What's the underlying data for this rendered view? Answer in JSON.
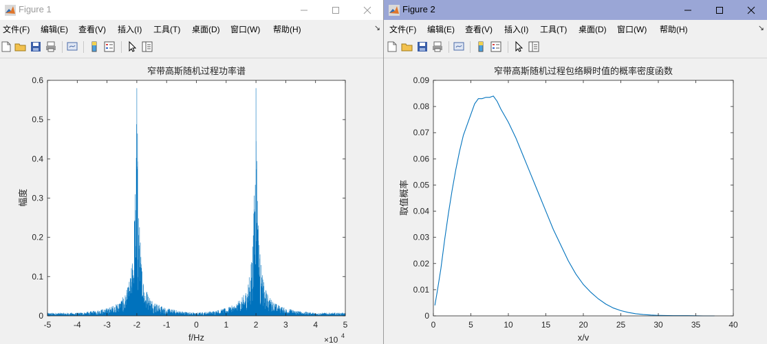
{
  "windows": [
    {
      "title": "Figure 1",
      "menu": [
        "文件(F)",
        "编辑(E)",
        "查看(V)",
        "插入(I)",
        "工具(T)",
        "桌面(D)",
        "窗口(W)",
        "帮助(H)"
      ]
    },
    {
      "title": "Figure 2",
      "menu": [
        "文件(F)",
        "编辑(E)",
        "查看(V)",
        "插入(I)",
        "工具(T)",
        "桌面(D)",
        "窗口(W)",
        "帮助(H)"
      ]
    }
  ],
  "icons": {
    "window_buttons": [
      "minimize-icon",
      "maximize-icon",
      "close-icon"
    ],
    "toolbar": [
      "new-figure-icon",
      "open-file-icon",
      "save-icon",
      "print-icon",
      "link-plot-icon",
      "insert-colorbar-icon",
      "insert-legend-icon",
      "edit-plot-arrow-icon",
      "property-inspector-icon"
    ],
    "accent_line_color": "#0072bd"
  },
  "chart_data": [
    {
      "type": "line",
      "title": "窄带高斯随机过程功率谱",
      "xlabel": "f/Hz",
      "ylabel": "幅度",
      "x_exponent_label": "×10",
      "x_exponent": "4",
      "xlim": [
        -5,
        5
      ],
      "ylim": [
        0,
        0.6
      ],
      "xticks": [
        "-5",
        "-4",
        "-3",
        "-2",
        "-1",
        "0",
        "1",
        "2",
        "3",
        "4",
        "5"
      ],
      "yticks": [
        "0",
        "0.1",
        "0.2",
        "0.3",
        "0.4",
        "0.5",
        "0.6"
      ],
      "grid": false,
      "series": [
        {
          "peaks_at_x": [
            -2,
            2
          ],
          "peak_values": [
            0.58,
            0.58
          ],
          "envelope_profile": {
            "offset_from_peak": [
              0,
              0.02,
              0.05,
              0.1,
              0.15,
              0.2,
              0.3,
              0.4,
              0.5,
              0.7,
              1.0,
              1.5,
              2.0
            ],
            "amplitude": [
              0.58,
              0.5,
              0.35,
              0.22,
              0.15,
              0.11,
              0.075,
              0.055,
              0.045,
              0.03,
              0.02,
              0.012,
              0.008
            ]
          }
        }
      ]
    },
    {
      "type": "line",
      "title": "窄带高斯随机过程包络瞬时值的概率密度函数",
      "xlabel": "x/v",
      "ylabel": "取值概率",
      "xlim": [
        0,
        40
      ],
      "ylim": [
        0,
        0.09
      ],
      "xticks": [
        "0",
        "5",
        "10",
        "15",
        "20",
        "25",
        "30",
        "35",
        "40"
      ],
      "yticks": [
        "0",
        "0.01",
        "0.02",
        "0.03",
        "0.04",
        "0.05",
        "0.06",
        "0.07",
        "0.08",
        "0.09"
      ],
      "grid": false,
      "series": [
        {
          "x": [
            0.2,
            0.5,
            1,
            1.5,
            2,
            2.5,
            3,
            3.5,
            4,
            4.5,
            5,
            5.5,
            6,
            6.5,
            7,
            7.5,
            8,
            8.5,
            9,
            10,
            11,
            12,
            13,
            14,
            15,
            16,
            17,
            18,
            19,
            20,
            21,
            22,
            23,
            24,
            25,
            26,
            27,
            28,
            29,
            30,
            32,
            34,
            36,
            37.5
          ],
          "y": [
            0.004,
            0.009,
            0.018,
            0.029,
            0.039,
            0.048,
            0.056,
            0.063,
            0.069,
            0.073,
            0.077,
            0.081,
            0.083,
            0.083,
            0.0835,
            0.0835,
            0.084,
            0.082,
            0.079,
            0.074,
            0.068,
            0.061,
            0.054,
            0.047,
            0.04,
            0.033,
            0.027,
            0.021,
            0.016,
            0.012,
            0.009,
            0.0065,
            0.0045,
            0.003,
            0.002,
            0.0013,
            0.0008,
            0.0005,
            0.0003,
            0.0002,
            0.0001,
            0.0001,
            0.0,
            0.0
          ]
        }
      ]
    }
  ]
}
